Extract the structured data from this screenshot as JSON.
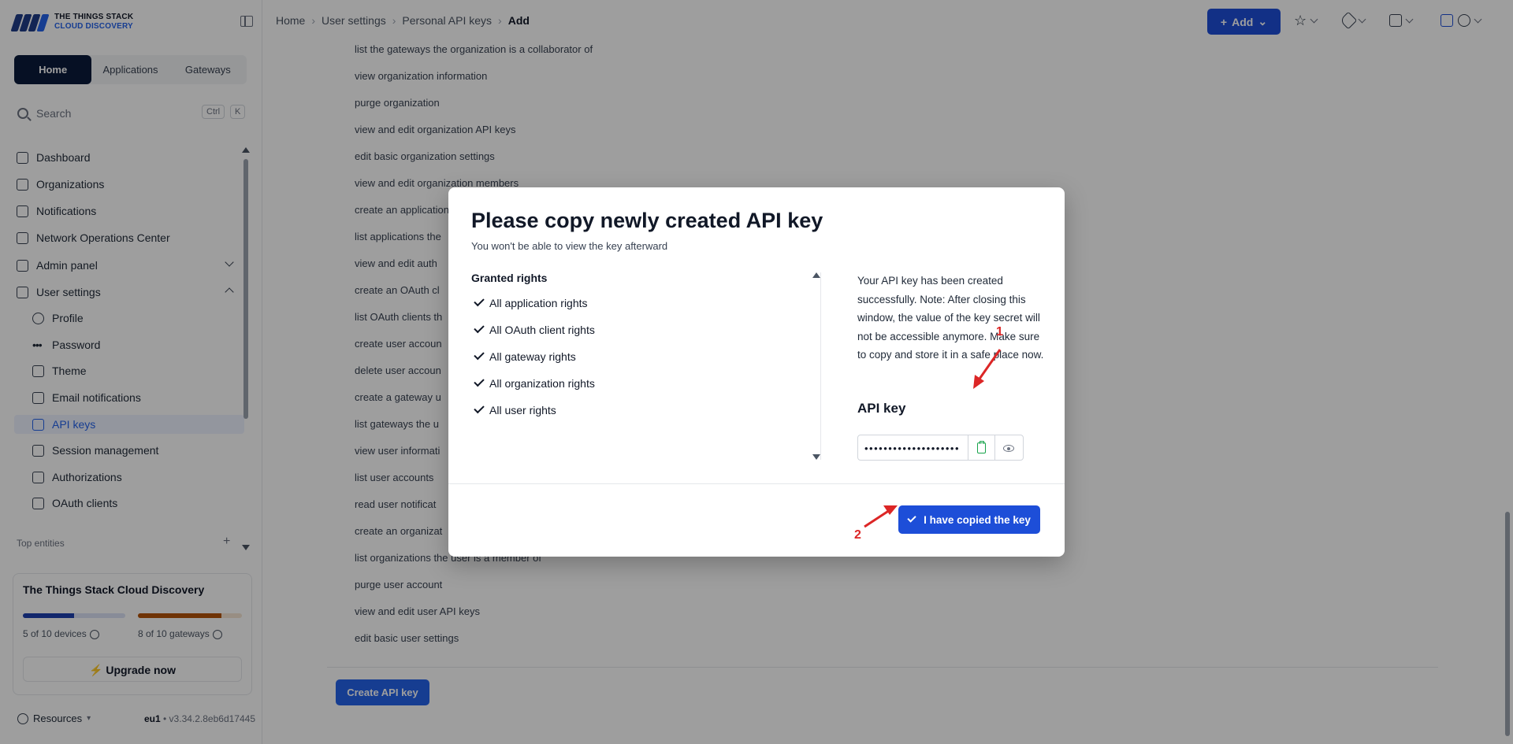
{
  "brand": {
    "line1": "THE THINGS STACK",
    "line2": "CLOUD DISCOVERY"
  },
  "sidebar": {
    "segments": [
      "Home",
      "Applications",
      "Gateways"
    ],
    "active_segment": "Home",
    "search": {
      "placeholder": "Search",
      "key1": "Ctrl",
      "key2": "K"
    },
    "items": [
      {
        "label": "Dashboard",
        "icon": "dashboard-icon"
      },
      {
        "label": "Organizations",
        "icon": "organizations-icon"
      },
      {
        "label": "Notifications",
        "icon": "inbox-icon"
      },
      {
        "label": "Network Operations Center",
        "icon": "chart-icon"
      },
      {
        "label": "Admin panel",
        "icon": "user-shield-icon"
      },
      {
        "label": "User settings",
        "icon": "user-gear-icon"
      }
    ],
    "user_settings_items": [
      {
        "label": "Profile",
        "icon": "profile-icon"
      },
      {
        "label": "Password",
        "icon": "password-icon"
      },
      {
        "label": "Theme",
        "icon": "brush-icon"
      },
      {
        "label": "Email notifications",
        "icon": "mail-icon"
      },
      {
        "label": "API keys",
        "icon": "key-icon"
      },
      {
        "label": "Session management",
        "icon": "shield-icon"
      },
      {
        "label": "Authorizations",
        "icon": "lock-icon"
      },
      {
        "label": "OAuth clients",
        "icon": "oauth-icon"
      }
    ],
    "top_entities_label": "Top entities",
    "plan": {
      "title": "The Things Stack Cloud Discovery",
      "devices_caption": "5 of 10 devices",
      "gateways_caption": "8 of 10 gateways",
      "devices_fraction": 0.5,
      "gateways_fraction": 0.8,
      "devices_color": "#1e40af",
      "gateways_color": "#b45309",
      "upgrade_label": "Upgrade now"
    },
    "resources_label": "Resources",
    "cluster": "eu1",
    "version": " • v3.34.2.8eb6d17445"
  },
  "header": {
    "breadcrumbs": [
      "Home",
      "User settings",
      "Personal API keys",
      "Add"
    ],
    "add_label": "Add"
  },
  "main": {
    "rights_list": [
      "list the gateways the organization is a collaborator of",
      "view organization information",
      "purge organization",
      "view and edit organization API keys",
      "edit basic organization settings",
      "view and edit organization members",
      "create an application",
      "list applications the",
      "view and edit auth",
      "create an OAuth cl",
      "list OAuth clients th",
      "create user accoun",
      "delete user accoun",
      "create a gateway u",
      "list gateways the u",
      "view user informati",
      "list user accounts",
      "read user notificat",
      "create an organizat",
      "list organizations the user is a member of",
      "purge user account",
      "view and edit user API keys",
      "edit basic user settings"
    ],
    "create_label": "Create API key"
  },
  "modal": {
    "title": "Please copy newly created API key",
    "subtitle": "You won't be able to view the key afterward",
    "granted_title": "Granted rights",
    "granted": [
      "All application rights",
      "All OAuth client rights",
      "All gateway rights",
      "All organization rights",
      "All user rights"
    ],
    "note": "Your API key has been created successfully. Note: After closing this window, the value of the key secret will not be accessible anymore. Make sure to copy and store it in a safe place now.",
    "api_key_label": "API key",
    "api_key_value": "••••••••••••••••••••",
    "confirm_label": "I have copied the key"
  },
  "annotations": {
    "a1": "1",
    "a2": "2",
    "color": "#dc2626"
  }
}
